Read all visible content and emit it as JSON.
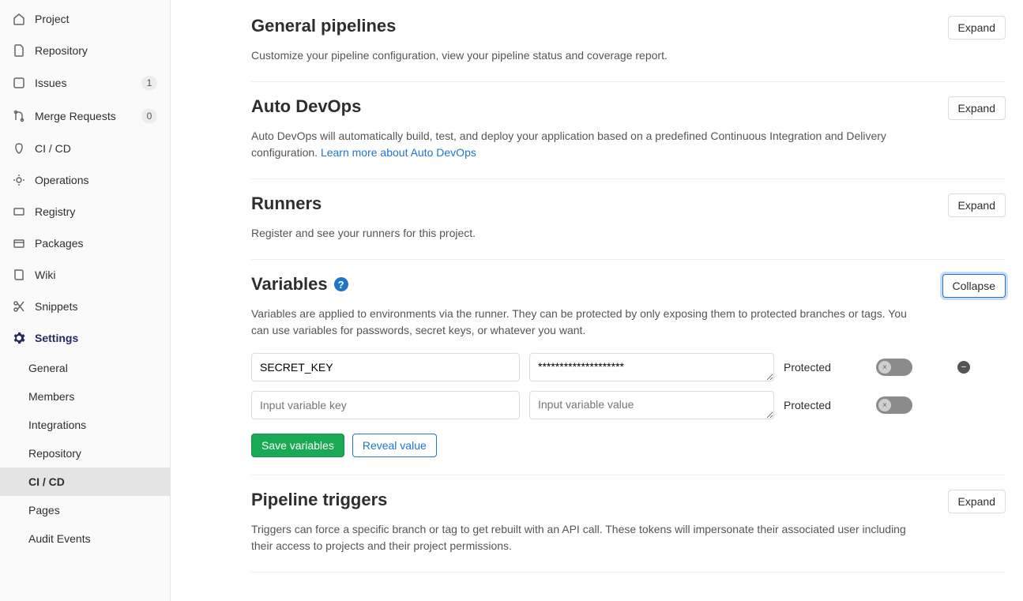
{
  "sidebar": {
    "items": [
      {
        "label": "Project"
      },
      {
        "label": "Repository"
      },
      {
        "label": "Issues",
        "badge": "1"
      },
      {
        "label": "Merge Requests",
        "badge": "0"
      },
      {
        "label": "CI / CD"
      },
      {
        "label": "Operations"
      },
      {
        "label": "Registry"
      },
      {
        "label": "Packages"
      },
      {
        "label": "Wiki"
      },
      {
        "label": "Snippets"
      },
      {
        "label": "Settings"
      }
    ],
    "settings_sub": [
      {
        "label": "General"
      },
      {
        "label": "Members"
      },
      {
        "label": "Integrations"
      },
      {
        "label": "Repository"
      },
      {
        "label": "CI / CD"
      },
      {
        "label": "Pages"
      },
      {
        "label": "Audit Events"
      }
    ]
  },
  "sections": {
    "general": {
      "title": "General pipelines",
      "desc": "Customize your pipeline configuration, view your pipeline status and coverage report.",
      "button": "Expand"
    },
    "autodevops": {
      "title": "Auto DevOps",
      "desc": "Auto DevOps will automatically build, test, and deploy your application based on a predefined Continuous Integration and Delivery configuration. ",
      "link": "Learn more about Auto DevOps",
      "button": "Expand"
    },
    "runners": {
      "title": "Runners",
      "desc": "Register and see your runners for this project.",
      "button": "Expand"
    },
    "variables": {
      "title": "Variables",
      "desc": "Variables are applied to environments via the runner. They can be protected by only exposing them to protected branches or tags. You can use variables for passwords, secret keys, or whatever you want.",
      "button": "Collapse",
      "rows": [
        {
          "key": "SECRET_KEY",
          "value": "********************",
          "protected_label": "Protected"
        },
        {
          "key_placeholder": "Input variable key",
          "value_placeholder": "Input variable value",
          "protected_label": "Protected"
        }
      ],
      "save_label": "Save variables",
      "reveal_label": "Reveal value"
    },
    "triggers": {
      "title": "Pipeline triggers",
      "desc": "Triggers can force a specific branch or tag to get rebuilt with an API call. These tokens will impersonate their associated user including their access to projects and their project permissions.",
      "button": "Expand"
    }
  }
}
